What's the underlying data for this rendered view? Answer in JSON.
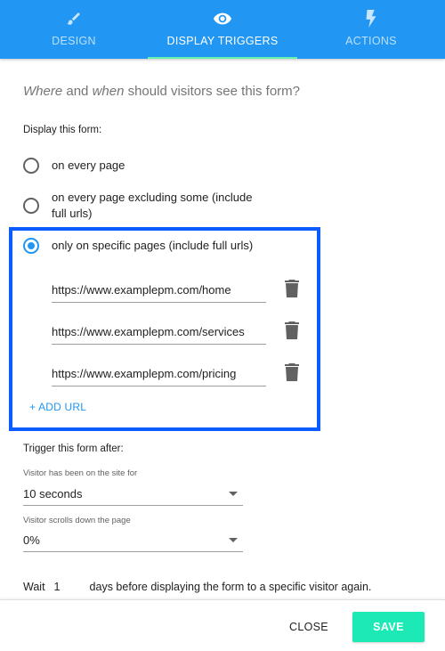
{
  "tabs": [
    {
      "label": "DESIGN",
      "icon": "brush-icon",
      "active": false
    },
    {
      "label": "DISPLAY TRIGGERS",
      "icon": "eye-icon",
      "active": true
    },
    {
      "label": "ACTIONS",
      "icon": "lightning-icon",
      "active": false
    }
  ],
  "question": {
    "part1": "Where",
    "part2": " and ",
    "part3": "when",
    "part4": " should visitors see this form?"
  },
  "display": {
    "label": "Display this form:",
    "options": [
      {
        "label": "on every page",
        "checked": false
      },
      {
        "label": "on every page excluding some (include full urls)",
        "checked": false
      },
      {
        "label": "only on specific pages (include full urls)",
        "checked": true
      }
    ],
    "urls": [
      "https://www.examplepm.com/home",
      "https://www.examplepm.com/services",
      "https://www.examplepm.com/pricing"
    ],
    "add_url_label": "+ ADD URL"
  },
  "trigger": {
    "label": "Trigger this form after:",
    "time": {
      "label": "Visitor has been on the site for",
      "value": "10 seconds"
    },
    "scroll": {
      "label": "Visitor scrolls down the page",
      "value": "0%"
    }
  },
  "wait": {
    "prefix": "Wait",
    "value": "1",
    "suffix": "days before displaying the form to a specific visitor again."
  },
  "footer": {
    "close_label": "CLOSE",
    "save_label": "SAVE"
  },
  "colors": {
    "primary": "#2196f3",
    "accent": "#1de9b6",
    "tab_indicator": "#69f0ae",
    "highlight_border": "#0b5cff"
  }
}
